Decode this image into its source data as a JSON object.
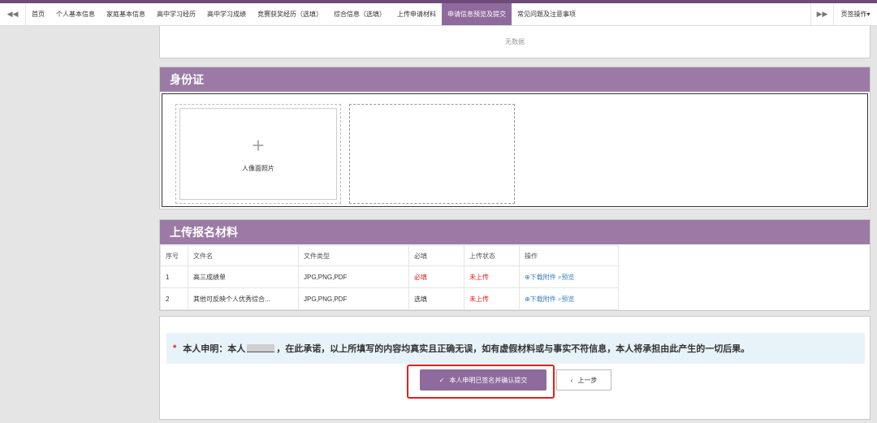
{
  "tabbar": {
    "prev_icon": "double-left-arrow",
    "next_icon": "double-right-arrow",
    "tabs": [
      {
        "label": "首页"
      },
      {
        "label": "个人基本信息"
      },
      {
        "label": "家庭基本信息"
      },
      {
        "label": "高中学习经历"
      },
      {
        "label": "高中学习成绩"
      },
      {
        "label": "竞赛获奖经历（选填）"
      },
      {
        "label": "综合信息（选填）"
      },
      {
        "label": "上传申请材料"
      },
      {
        "label": "申请信息预览及提交",
        "active": true
      },
      {
        "label": "常见问题及注意事项"
      }
    ],
    "ops_label": "页签操作"
  },
  "nodata": "无数据",
  "id_section": {
    "title": "身份证",
    "upload_label": "人像面照片"
  },
  "materials": {
    "title": "上传报名材料",
    "columns": [
      "序号",
      "文件名",
      "文件类型",
      "必填",
      "上传状态",
      "操作"
    ],
    "rows": [
      {
        "no": "1",
        "name": "高三成绩单",
        "type": "JPG,PNG,PDF",
        "required": "必填",
        "status": "未上传",
        "download": "下载附件",
        "preview": "预览"
      },
      {
        "no": "2",
        "name": "其他可反映个人优秀综合...",
        "type": "JPG,PNG,PDF",
        "required": "选填",
        "status": "未上传",
        "download": "下载附件",
        "preview": "预览"
      }
    ]
  },
  "declaration": {
    "star": "*",
    "prefix": "本人申明：本人",
    "suffix": "，在此承诺，以上所填写的内容均真实且正确无误，如有虚假材料或与事实不符信息，本人将承担由此产生的一切后果。"
  },
  "buttons": {
    "submit": "本人申明已签名并确认提交",
    "prev": "上一步"
  },
  "colors": {
    "accent": "#8f6a9c",
    "header": "#9b7ba5",
    "required": "#e02020",
    "link": "#3a7fc6",
    "highlight": "#e0201b"
  }
}
